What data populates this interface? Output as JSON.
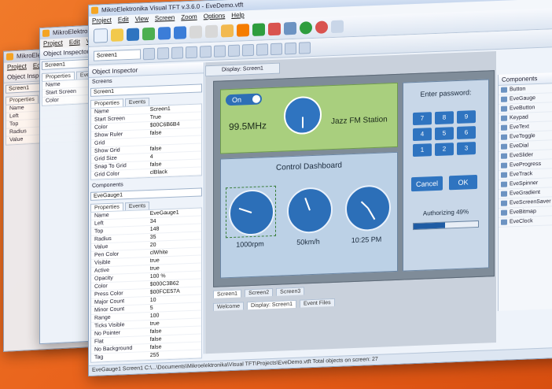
{
  "window_title": "MikroElektronika Visual TFT v.3.6.0 - EveDemo.vtft",
  "back_window_title": "MikroElektronika Visu",
  "menu": [
    "Project",
    "Edit",
    "View",
    "Screen",
    "Zoom",
    "Options",
    "Help"
  ],
  "object_inspector": {
    "title": "Object Inspector",
    "screens_label": "Screens",
    "screen_value": "Screen1",
    "tabs": [
      "Properties",
      "Events"
    ],
    "screen_props": [
      {
        "k": "Name",
        "v": "Screen1"
      },
      {
        "k": "Start Screen",
        "v": "True"
      },
      {
        "k": "Color",
        "v": "$00C6B6B4"
      },
      {
        "k": "Show Ruler",
        "v": "false"
      },
      {
        "k": "Grid",
        "v": ""
      },
      {
        "k": "Show Grid",
        "v": "false"
      },
      {
        "k": "Grid Size",
        "v": "4"
      },
      {
        "k": "Snap To Grid",
        "v": "false"
      },
      {
        "k": "Grid Color",
        "v": "clBlack"
      }
    ],
    "components_label": "Components",
    "component_value": "EveGauge1",
    "component_props": [
      {
        "k": "Name",
        "v": "EveGauge1"
      },
      {
        "k": "Left",
        "v": "34"
      },
      {
        "k": "Top",
        "v": "148"
      },
      {
        "k": "Radius",
        "v": "35"
      },
      {
        "k": "Value",
        "v": "20"
      },
      {
        "k": "Pen Color",
        "v": "clWhite"
      },
      {
        "k": "Visible",
        "v": "true"
      },
      {
        "k": "Active",
        "v": "true"
      },
      {
        "k": "Opacity",
        "v": "100 %"
      },
      {
        "k": "Color",
        "v": "$000C3B62"
      },
      {
        "k": "Press Color",
        "v": "$00FCE57A"
      },
      {
        "k": "Major Count",
        "v": "10"
      },
      {
        "k": "Minor Count",
        "v": "5"
      },
      {
        "k": "Range",
        "v": "100"
      },
      {
        "k": "Ticks Visible",
        "v": "true"
      },
      {
        "k": "No Pointer",
        "v": "false"
      },
      {
        "k": "Flat",
        "v": "false"
      },
      {
        "k": "No Background",
        "v": "false"
      },
      {
        "k": "Tag",
        "v": "255"
      }
    ]
  },
  "display_tab": "Display: Screen1",
  "radio": {
    "toggle": "On",
    "freq": "99.5MHz",
    "station": "Jazz FM Station"
  },
  "dashboard": {
    "title": "Control Dashboard",
    "gauges": [
      {
        "label": "1000rpm"
      },
      {
        "label": "50km/h"
      },
      {
        "label": "10:25 PM"
      }
    ]
  },
  "password": {
    "title": "Enter password:",
    "keys": [
      "7",
      "8",
      "9",
      "4",
      "5",
      "6",
      "1",
      "2",
      "3"
    ],
    "cancel": "Cancel",
    "ok": "OK",
    "status": "Authorizing 49%",
    "progress": 0.49
  },
  "screen_tabs": [
    "Screen1",
    "Screen2",
    "Screen3"
  ],
  "bottom_tabs": [
    "Welcome",
    "Display: Screen1",
    "Event Files"
  ],
  "status": "EveGauge1   Screen1   C:\\...\\Documents\\Mikroelektronika\\Visual TFT\\Projects\\EveDemo.vtft   Total objects on screen: 27",
  "right_panel": {
    "title": "Components",
    "items": [
      "Button",
      "EveGauge",
      "EveButton",
      "Keypad",
      "EveText",
      "EveToggle",
      "EveDial",
      "EveSlider",
      "EveProgress",
      "EveTrack",
      "EveSpinner",
      "EveGradient",
      "EveScreenSaver",
      "EveBitmap",
      "EveClock"
    ]
  }
}
